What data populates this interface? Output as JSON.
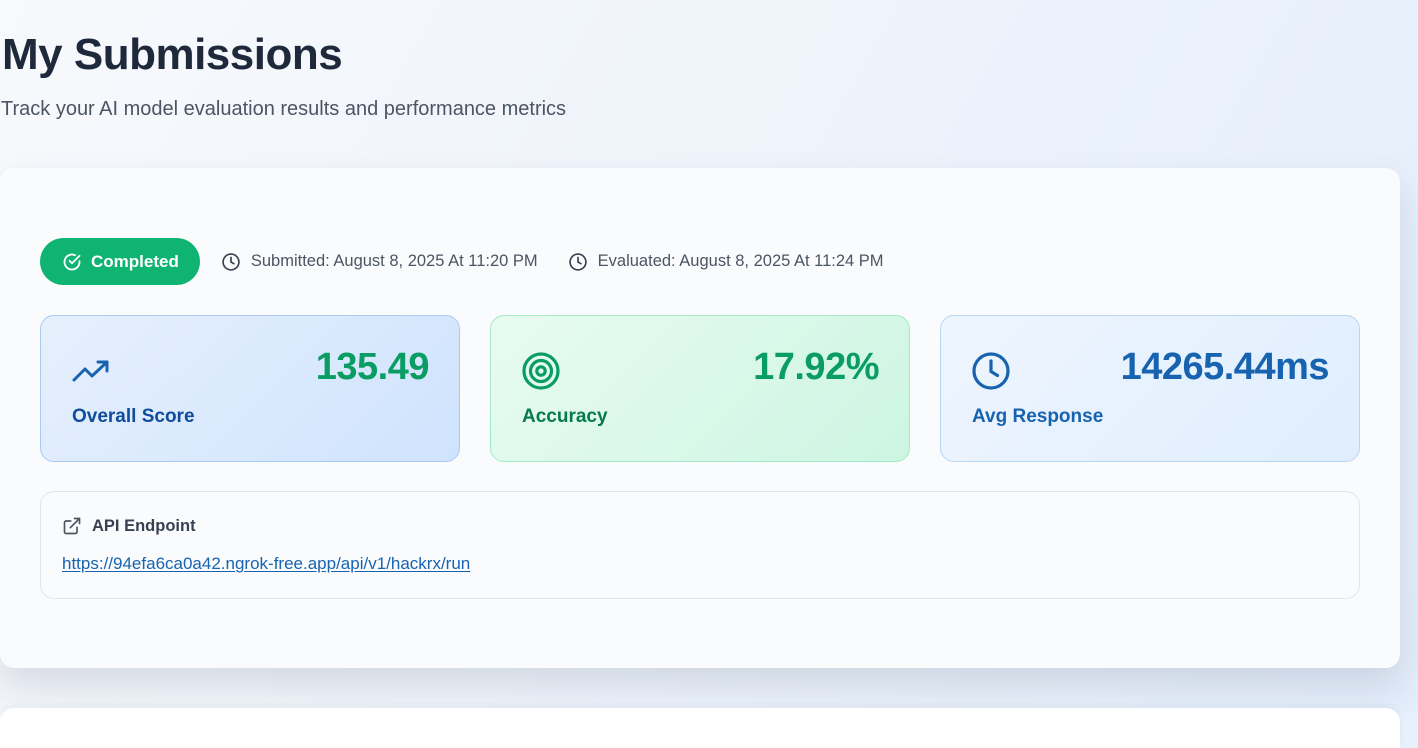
{
  "header": {
    "title": "My Submissions",
    "subtitle": "Track your AI model evaluation results and performance metrics"
  },
  "submission": {
    "status": "Completed",
    "submitted": "Submitted: August 8, 2025 At 11:20 PM",
    "evaluated": "Evaluated: August 8, 2025 At 11:24 PM",
    "metrics": {
      "score": {
        "value": "135.49",
        "label": "Overall Score",
        "icon": "trending-up-icon"
      },
      "accuracy": {
        "value": "17.92%",
        "label": "Accuracy",
        "icon": "target-icon"
      },
      "response": {
        "value": "14265.44ms",
        "label": "Avg Response",
        "icon": "clock-icon"
      }
    },
    "endpoint": {
      "label": "API Endpoint",
      "url": "https://94efa6ca0a42.ngrok-free.app/api/v1/hackrx/run"
    }
  },
  "colors": {
    "status_green": "#10b472",
    "score_value": "#0a9d63",
    "score_label": "#0f4c9c",
    "accuracy_label": "#067a4b",
    "response_blue": "#1763b0",
    "link_blue": "#1763b0"
  }
}
